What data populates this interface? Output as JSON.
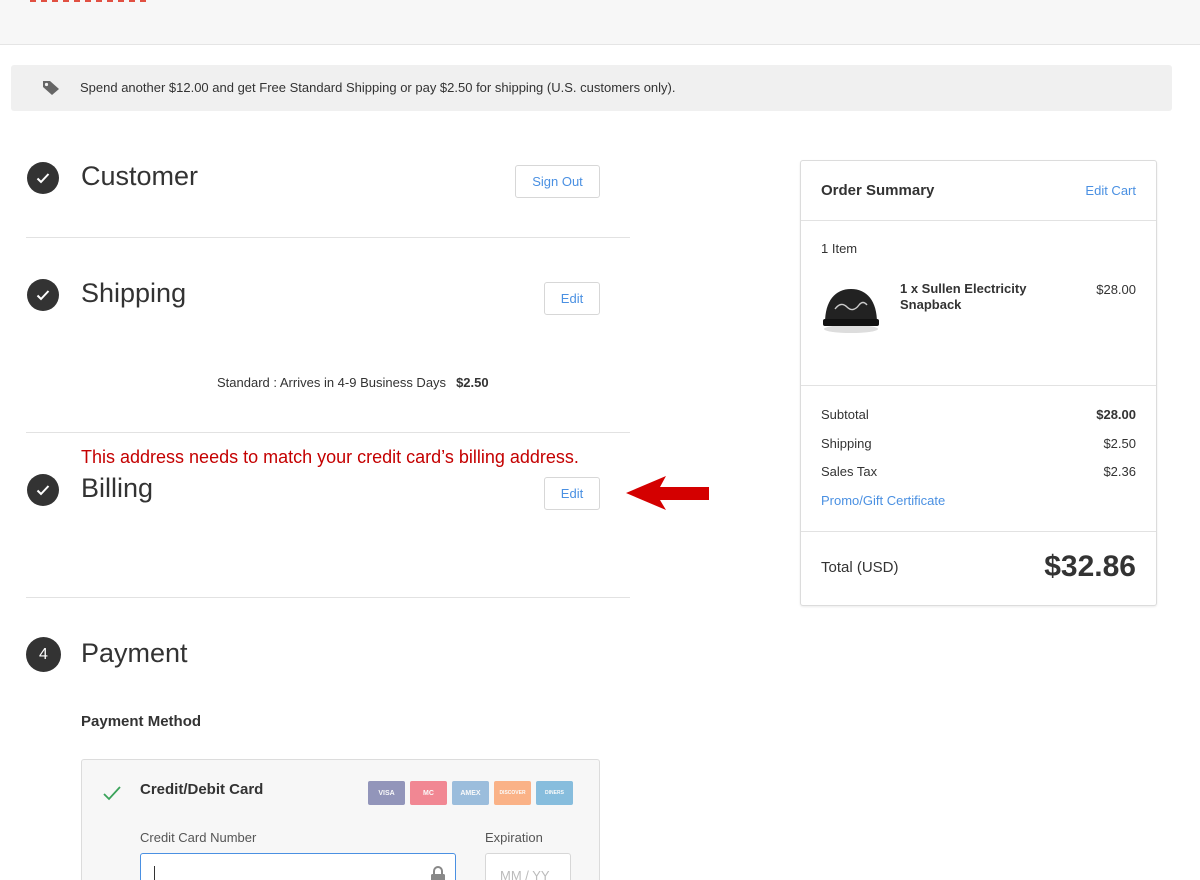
{
  "banner": {
    "icon": "tag-icon",
    "text": "Spend another $12.00 and get Free Standard Shipping or pay $2.50 for shipping (U.S. customers only)."
  },
  "steps": {
    "customer": {
      "title": "Customer",
      "button": "Sign Out",
      "status": "completed"
    },
    "shipping": {
      "title": "Shipping",
      "button": "Edit",
      "status": "completed",
      "method_text": "Standard : Arrives in 4-9 Business Days",
      "method_price": "$2.50"
    },
    "billing": {
      "title": "Billing",
      "button": "Edit",
      "status": "completed",
      "warning": "This address needs to match your credit card’s billing address."
    },
    "payment": {
      "number": "4",
      "title": "Payment",
      "method_label": "Payment Method",
      "option_title": "Credit/Debit Card",
      "card_logos": [
        "VISA",
        "MC",
        "AMEX",
        "DISCOVER",
        "DINERS"
      ],
      "cc_label": "Credit Card Number",
      "cc_value": "",
      "exp_label": "Expiration",
      "exp_placeholder": "MM / YY"
    }
  },
  "summary": {
    "title": "Order Summary",
    "edit_link": "Edit Cart",
    "item_count": "1 Item",
    "items": [
      {
        "name": "1 x Sullen Electricity Snapback",
        "price": "$28.00",
        "image": "black-snapback-cap"
      }
    ],
    "rows": [
      {
        "label": "Subtotal",
        "value": "$28.00",
        "bold": true
      },
      {
        "label": "Shipping",
        "value": "$2.50",
        "bold": false
      },
      {
        "label": "Sales Tax",
        "value": "$2.36",
        "bold": false
      }
    ],
    "promo_link": "Promo/Gift Certificate",
    "total_label": "Total (USD)",
    "total_value": "$32.86"
  },
  "colors": {
    "accent": "#4a90e2",
    "warning": "#c40000",
    "arrow": "#d40000",
    "step_badge": "#333333"
  }
}
